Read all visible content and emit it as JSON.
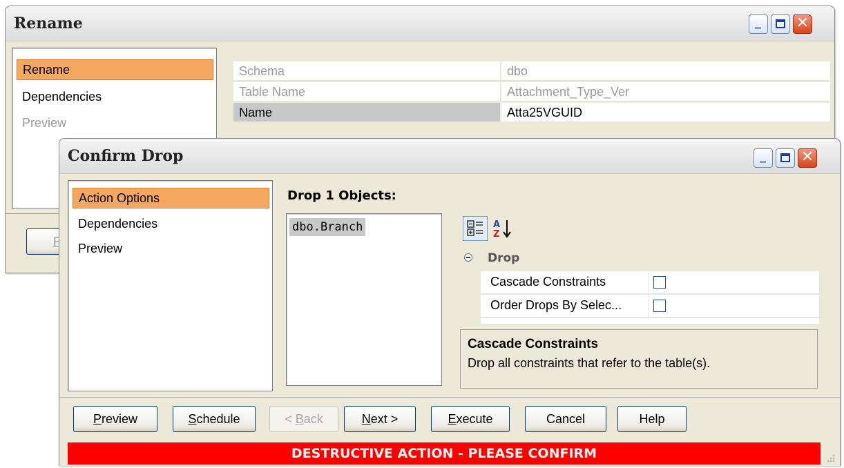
{
  "rename_window": {
    "title": "Rename",
    "nav": [
      "Rename",
      "Dependencies",
      "Preview"
    ],
    "grid": [
      {
        "label": "Schema",
        "value": "dbo"
      },
      {
        "label": "Table Name",
        "value": "Attachment_Type_Ver"
      },
      {
        "label": "Name",
        "value": "Atta25VGUID"
      }
    ],
    "partial_button_label": "P"
  },
  "confirm_window": {
    "title": "Confirm Drop",
    "nav": [
      "Action Options",
      "Dependencies",
      "Preview"
    ],
    "drop_heading": "Drop 1 Objects:",
    "objects": [
      "dbo.Branch"
    ],
    "property_category": "Drop",
    "properties": [
      {
        "label": "Cascade Constraints",
        "checked": false
      },
      {
        "label": "Order Drops By Selec...",
        "checked": false
      }
    ],
    "description_title": "Cascade Constraints",
    "description_text": "Drop all constraints that refer to the table(s).",
    "buttons": {
      "preview": {
        "accel": "P",
        "rest": "review"
      },
      "schedule": {
        "accel": "S",
        "rest": "chedule"
      },
      "back": {
        "pre": "< ",
        "accel": "B",
        "rest": "ack"
      },
      "next": {
        "accel": "N",
        "rest": "ext >"
      },
      "execute": {
        "accel": "E",
        "rest": "xecute"
      },
      "cancel": "Cancel",
      "help": "Help"
    },
    "warning": "DESTRUCTIVE ACTION - PLEASE CONFIRM"
  },
  "colors": {
    "selection": "#f7a860",
    "warning_bar": "#ff0000",
    "window_bg": "#ece9d8"
  }
}
